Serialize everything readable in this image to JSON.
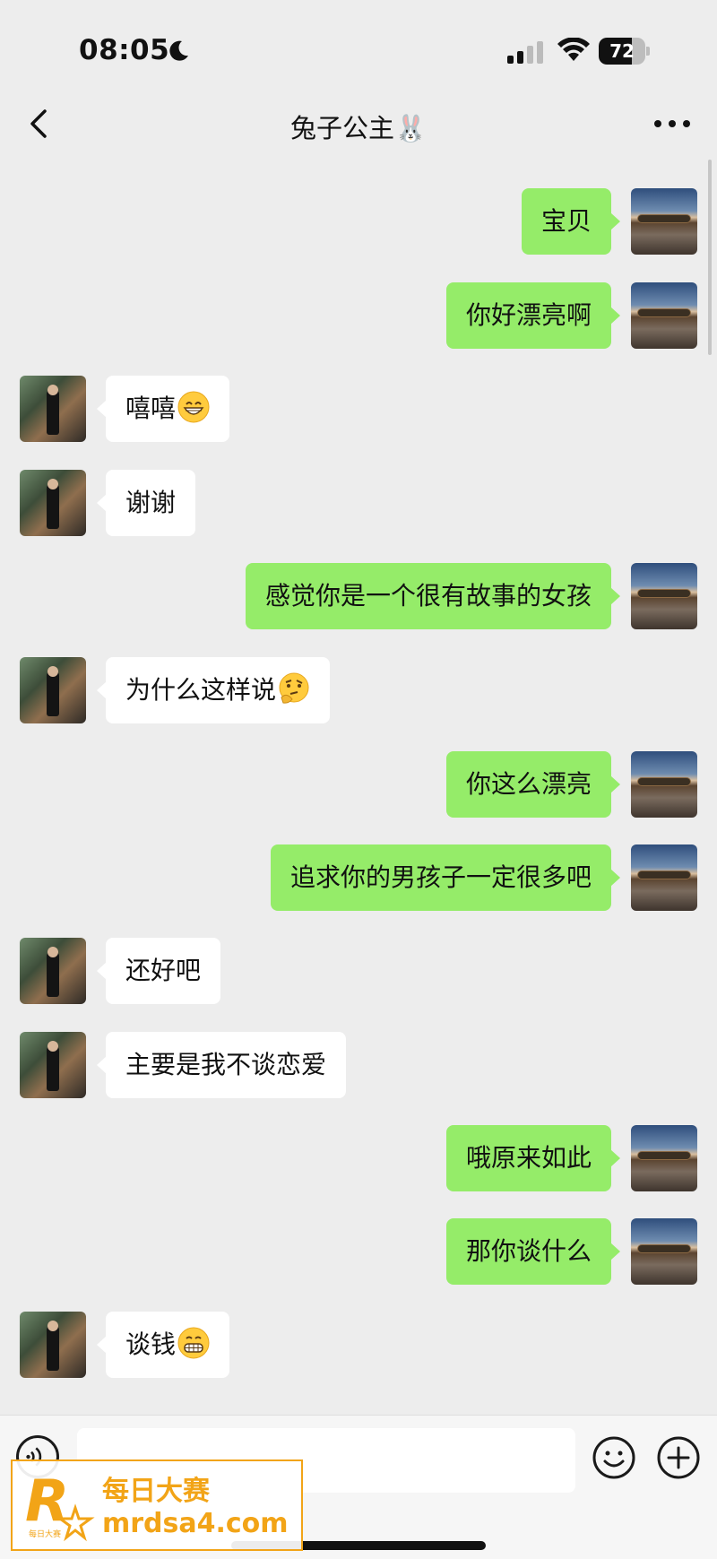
{
  "status_bar": {
    "time": "08:05",
    "battery_percent": 72,
    "battery_label": "72",
    "icons": [
      "moon-icon",
      "signal-icon",
      "wifi-icon",
      "battery-icon"
    ]
  },
  "header": {
    "title": "兔子公主🐰",
    "back_icon": "chevron-left-icon",
    "more_icon": "more-dots-icon"
  },
  "messages": [
    {
      "from": "me",
      "text": "宝贝"
    },
    {
      "from": "me",
      "text": "你好漂亮啊"
    },
    {
      "from": "them",
      "text": "嘻嘻",
      "emoji": "grinning-face"
    },
    {
      "from": "them",
      "text": "谢谢"
    },
    {
      "from": "me",
      "text": "感觉你是一个很有故事的女孩"
    },
    {
      "from": "them",
      "text": "为什么这样说",
      "emoji": "thinking-face"
    },
    {
      "from": "me",
      "text": "你这么漂亮"
    },
    {
      "from": "me",
      "text": "追求你的男孩子一定很多吧"
    },
    {
      "from": "them",
      "text": "还好吧"
    },
    {
      "from": "them",
      "text": "主要是我不谈恋爱"
    },
    {
      "from": "me",
      "text": "哦原来如此"
    },
    {
      "from": "me",
      "text": "那你谈什么"
    },
    {
      "from": "them",
      "text": "谈钱",
      "emoji": "grimacing-face"
    }
  ],
  "input_bar": {
    "value": "",
    "placeholder": "",
    "icons": [
      "voice-icon",
      "emoji-icon",
      "plus-icon"
    ]
  },
  "colors": {
    "background": "#ededed",
    "outgoing_bubble": "#95ec69",
    "incoming_bubble": "#ffffff",
    "watermark": "#f2a417"
  },
  "watermark": {
    "line1": "每日大赛",
    "line2": "mrdsa4.com",
    "logo_letter": "R",
    "logo_small": "每日大赛"
  }
}
